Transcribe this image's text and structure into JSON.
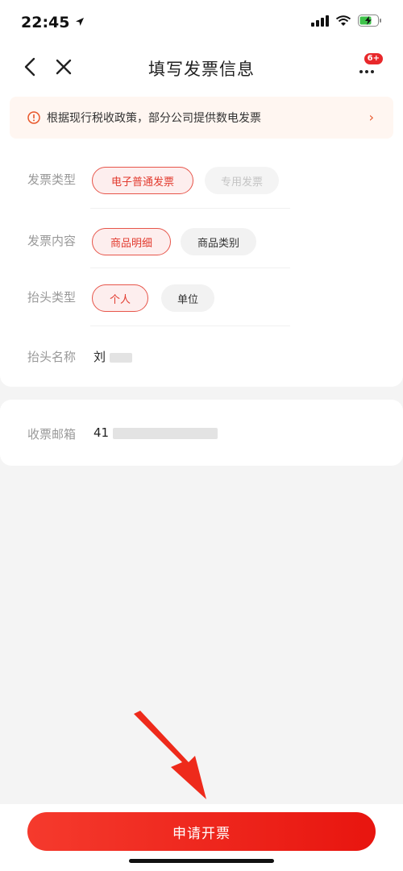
{
  "status_bar": {
    "time": "22:45",
    "icons": [
      "location-arrow-icon",
      "signal-icon",
      "wifi-icon",
      "battery-charging-icon"
    ]
  },
  "nav": {
    "title": "填写发票信息",
    "badge": "6+",
    "icons": [
      "back-chevron-icon",
      "close-icon",
      "more-dots-icon"
    ]
  },
  "notice": {
    "text": "根据现行税收政策，部分公司提供数电发票",
    "chevron": "›"
  },
  "form": {
    "invoice_type": {
      "label": "发票类型",
      "options": [
        {
          "label": "电子普通发票",
          "state": "selected"
        },
        {
          "label": "专用发票",
          "state": "disabled"
        }
      ]
    },
    "invoice_content": {
      "label": "发票内容",
      "options": [
        {
          "label": "商品明细",
          "state": "selected"
        },
        {
          "label": "商品类别",
          "state": "normal"
        }
      ]
    },
    "title_type": {
      "label": "抬头类型",
      "options": [
        {
          "label": "个人",
          "state": "selected"
        },
        {
          "label": "单位",
          "state": "normal"
        }
      ]
    },
    "title_name": {
      "label": "抬头名称",
      "value_visible_prefix": "刘"
    },
    "email": {
      "label": "收票邮箱",
      "value_visible_prefix": "41"
    }
  },
  "footer": {
    "submit_label": "申请开票"
  },
  "colors": {
    "accent": "#e8150f",
    "chip_selected_bg": "#fdeeee",
    "notice_bg": "#fff6f1"
  }
}
